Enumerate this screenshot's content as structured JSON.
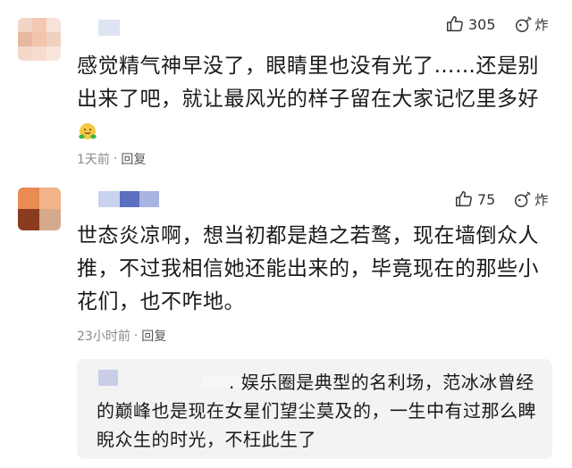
{
  "comments": [
    {
      "text": "感觉精气神早没了，眼睛里也没有光了……还是别出来了吧，就让最风光的样子留在大家记忆里多好",
      "time": "1天前",
      "reply_label": "回复",
      "likes": "305",
      "bomb_label": "炸"
    },
    {
      "text": "世态炎凉啊，想当初都是趋之若鹜，现在墙倒众人推，不过我相信她还能出来的，毕竟现在的那些小花们，也不咋地。",
      "time": "23小时前",
      "reply_label": "回复",
      "likes": "75",
      "bomb_label": "炸",
      "sub_reply": {
        "prefix": ".",
        "text": "娱乐圈是典型的名利场，范冰冰曾经的巅峰也是现在女星们望尘莫及的，一生中有过那么睥睨众生的时光，不枉此生了"
      }
    }
  ],
  "meta_separator": "·",
  "icons": {
    "like": "thumbs-up-icon",
    "bomb": "bomb-icon",
    "emoji": "hugging-face-emoji"
  }
}
